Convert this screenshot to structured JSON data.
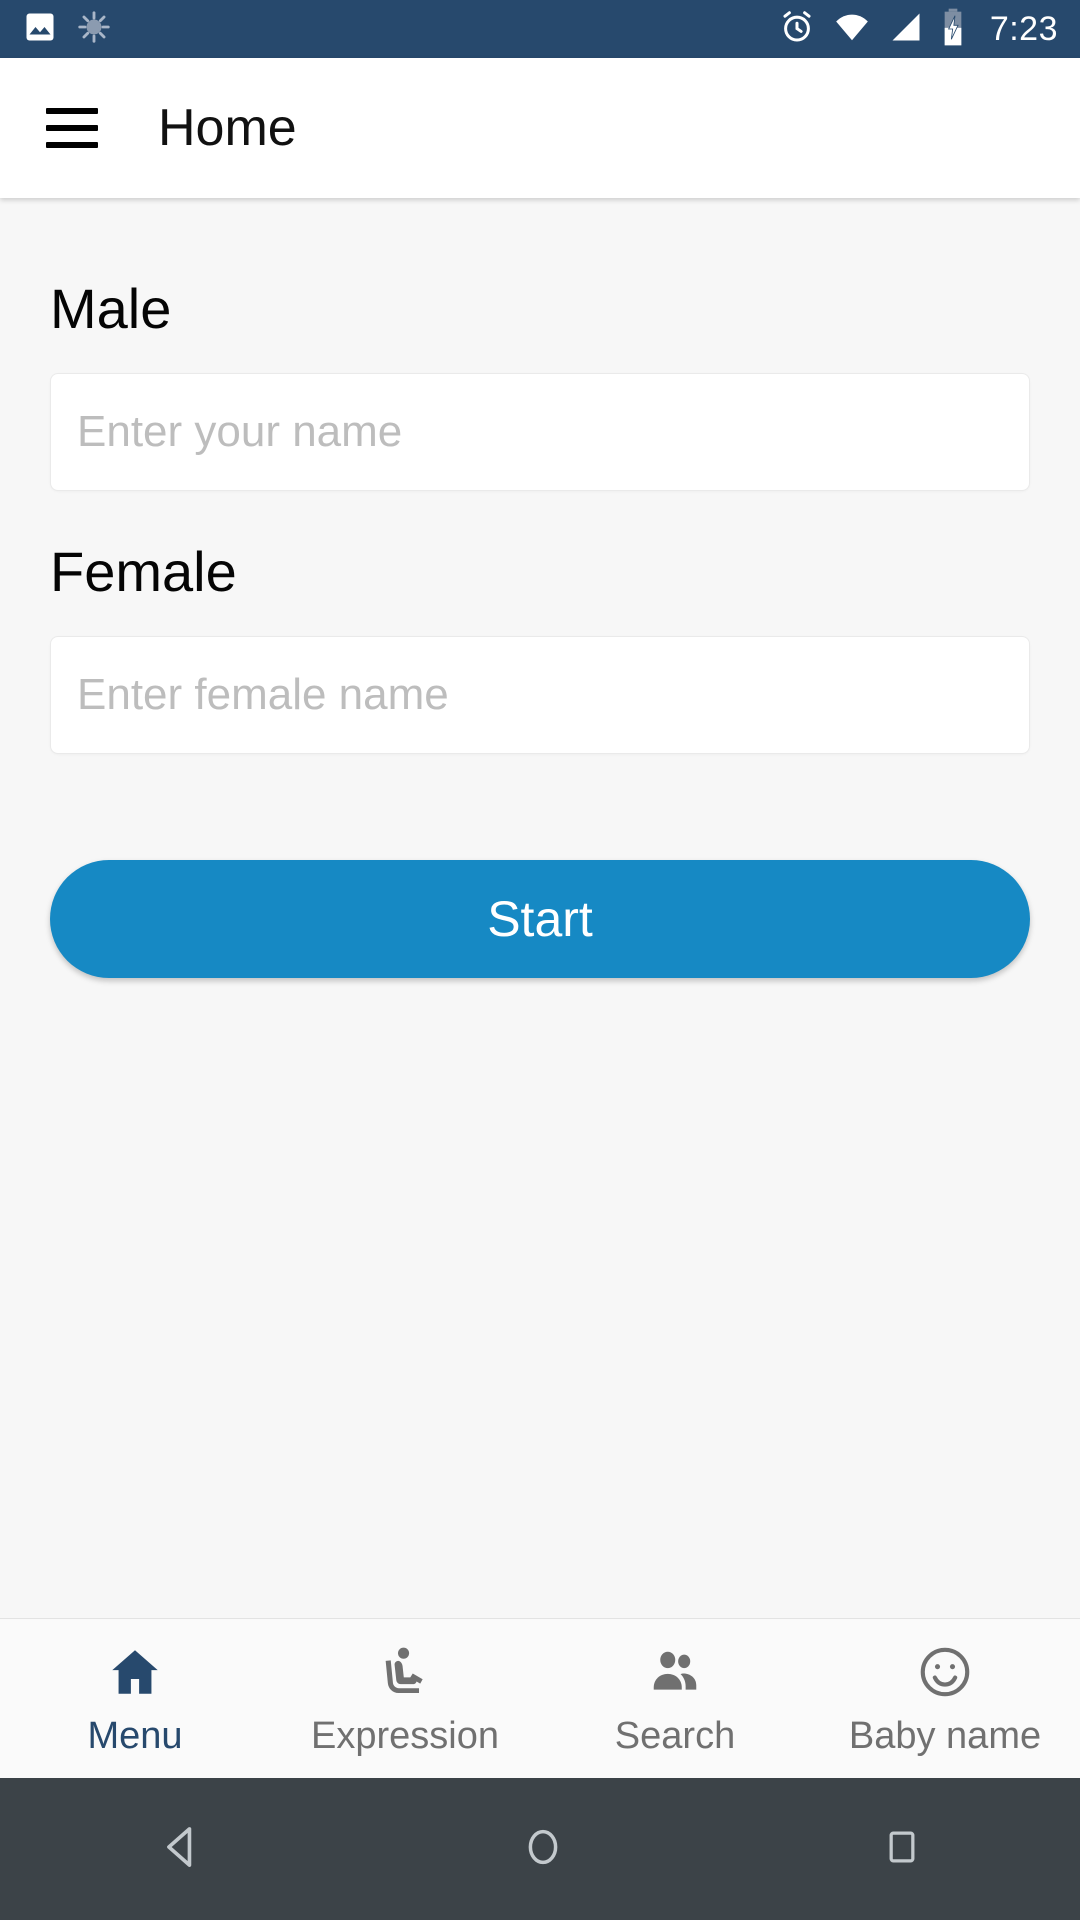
{
  "status_bar": {
    "background": "#27496d",
    "time": "7:23",
    "left_icons": [
      "image-icon",
      "sync-spinner-icon"
    ],
    "right_icons": [
      "alarm-icon",
      "wifi-icon",
      "cellular-signal-icon",
      "battery-charging-icon"
    ]
  },
  "app_bar": {
    "menu_icon": "hamburger-menu-icon",
    "title": "Home"
  },
  "form": {
    "male": {
      "label": "Male",
      "placeholder": "Enter your name",
      "value": ""
    },
    "female": {
      "label": "Female",
      "placeholder": "Enter female name",
      "value": ""
    },
    "start_button": {
      "label": "Start",
      "color": "#1689c4",
      "text_color": "#ffffff"
    }
  },
  "bottom_tabs": {
    "active_color": "#27496d",
    "inactive_color": "#707070",
    "items": [
      {
        "label": "Menu",
        "icon": "home-icon",
        "active": true
      },
      {
        "label": "Expression",
        "icon": "airline-seat-icon",
        "active": false
      },
      {
        "label": "Search",
        "icon": "people-icon",
        "active": false
      },
      {
        "label": "Baby name",
        "icon": "smiley-face-icon",
        "active": false
      }
    ]
  },
  "android_nav": {
    "background": "#3c4348",
    "buttons": [
      "back-icon",
      "home-circle-icon",
      "recents-square-icon"
    ]
  }
}
